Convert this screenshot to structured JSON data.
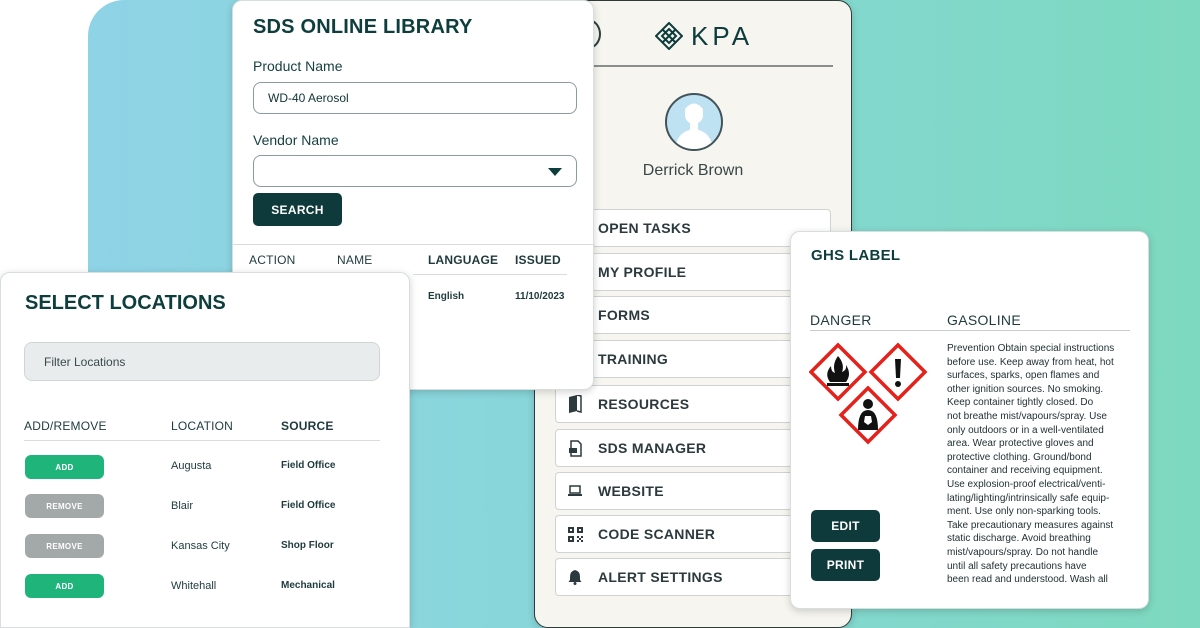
{
  "colors": {
    "brand_dark": "#0f3a3c",
    "add_green": "#1fb57a",
    "remove_gray": "#a3a8a9",
    "ghs_red": "#e5211b"
  },
  "kpa_panel": {
    "logo_text": "KPA",
    "user_name": "Derrick Brown",
    "menu": [
      {
        "label": "OPEN TASKS",
        "icon": "none"
      },
      {
        "label": "MY PROFILE",
        "icon": "none"
      },
      {
        "label": "FORMS",
        "icon": "none"
      },
      {
        "label": "TRAINING",
        "icon": "none"
      },
      {
        "label": "RESOURCES",
        "icon": "book-icon"
      },
      {
        "label": "SDS MANAGER",
        "icon": "document-icon"
      },
      {
        "label": "WEBSITE",
        "icon": "laptop-icon"
      },
      {
        "label": "CODE SCANNER",
        "icon": "qr-code-icon"
      },
      {
        "label": "ALERT SETTINGS",
        "icon": "bell-icon"
      }
    ]
  },
  "sds_library": {
    "title": "SDS ONLINE LIBRARY",
    "product_label": "Product Name",
    "product_value": "WD-40 Aerosol",
    "vendor_label": "Vendor Name",
    "vendor_value": "",
    "search_button": "SEARCH",
    "columns": [
      "ACTION",
      "NAME",
      "LANGUAGE",
      "ISSUED"
    ],
    "rows": [
      {
        "action": "",
        "name": "",
        "language": "English",
        "issued": "11/10/2023"
      }
    ]
  },
  "locations": {
    "title": "SELECT LOCATIONS",
    "filter_placeholder": "Filter Locations",
    "columns": [
      "ADD/REMOVE",
      "LOCATION",
      "SOURCE"
    ],
    "rows": [
      {
        "action": "ADD",
        "location": "Augusta",
        "source": "Field Office"
      },
      {
        "action": "REMOVE",
        "location": "Blair",
        "source": "Field Office"
      },
      {
        "action": "REMOVE",
        "location": "Kansas City",
        "source": "Shop Floor"
      },
      {
        "action": "ADD",
        "location": "Whitehall",
        "source": "Mechanical"
      }
    ]
  },
  "ghs_label": {
    "title": "GHS LABEL",
    "signal_word": "DANGER",
    "product": "GASOLINE",
    "pictograms": [
      "flame-pictogram",
      "exclamation-pictogram",
      "health-hazard-pictogram"
    ],
    "edit_button": "EDIT",
    "print_button": "PRINT",
    "statement": "Prevention Obtain special instructions\nbefore use. Keep away from heat, hot\nsurfaces, sparks, open flames and\nother ignition sources. No smoking.\nKeep container tightly closed. Do\nnot breathe mist/vapours/spray. Use\nonly outdoors or in a well-ventilated\narea. Wear protective gloves and\nprotective clothing. Ground/bond\ncontainer and receiving equipment.\nUse explosion-proof electrical/venti-\nlating/lighting/intrinsically safe equip-\nment. Use only non-sparking tools.\nTake precautionary measures against\nstatic discharge. Avoid breathing\nmist/vapours/spray. Do not handle\nuntil all safety precautions have\nbeen read and understood. Wash all"
  }
}
